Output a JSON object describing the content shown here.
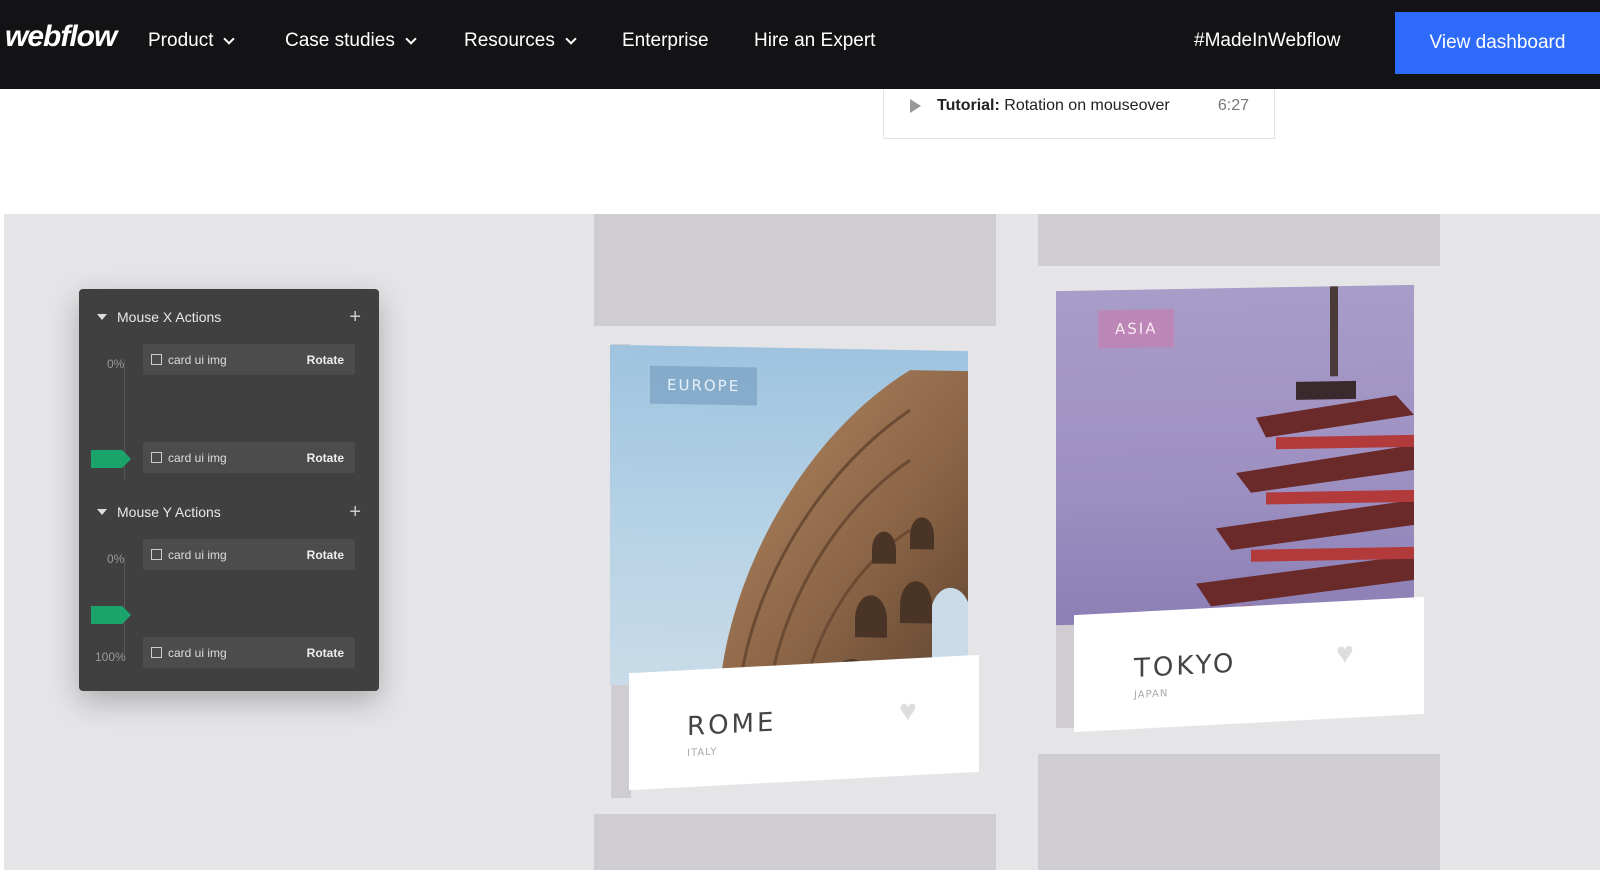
{
  "nav": {
    "logo": "webflow",
    "items": [
      {
        "label": "Product",
        "dropdown": true
      },
      {
        "label": "Case studies",
        "dropdown": true
      },
      {
        "label": "Resources",
        "dropdown": true
      },
      {
        "label": "Enterprise",
        "dropdown": false
      },
      {
        "label": "Hire an Expert",
        "dropdown": false
      }
    ],
    "hashtag": "#MadeInWebflow",
    "cta": "View dashboard"
  },
  "tutorial": {
    "prefix": "Tutorial:",
    "title": "Rotation on mouseover",
    "duration": "6:27"
  },
  "panel": {
    "x_section": "Mouse X Actions",
    "y_section": "Mouse Y Actions",
    "add_symbol": "+",
    "x_rows": [
      {
        "pct": "0%",
        "target": "card ui img",
        "action": "Rotate"
      },
      {
        "pct": "",
        "target": "card ui img",
        "action": "Rotate"
      }
    ],
    "y_rows": [
      {
        "pct": "0%",
        "target": "card ui img",
        "action": "Rotate"
      },
      {
        "pct": "100%",
        "target": "card ui img",
        "action": "Rotate"
      }
    ]
  },
  "cards": [
    {
      "tag": "EUROPE",
      "city": "ROME",
      "country": "ITALY"
    },
    {
      "tag": "ASIA",
      "city": "TOKYO",
      "country": "JAPAN"
    }
  ],
  "colors": {
    "nav_bg": "#131214",
    "cta_bg": "#2e6bfa",
    "marker": "#1aa36b",
    "stage_bg": "#e5e4e7"
  }
}
